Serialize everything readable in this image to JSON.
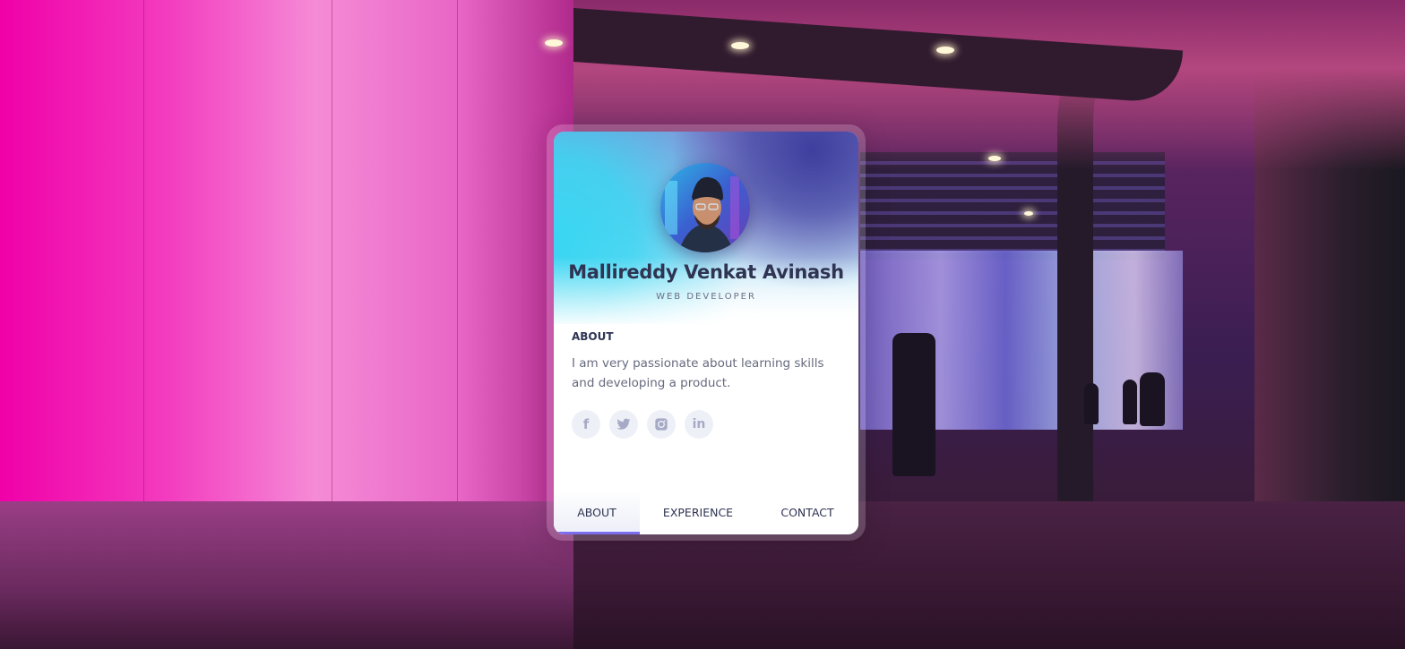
{
  "profile": {
    "name": "Mallireddy Venkat Avinash",
    "role": "WEB DEVELOPER"
  },
  "about": {
    "title": "ABOUT",
    "text": "I am very passionate about learning skills and developing a product."
  },
  "socials": [
    {
      "icon": "facebook-icon",
      "glyph": "f"
    },
    {
      "icon": "twitter-icon",
      "glyph": ""
    },
    {
      "icon": "instagram-icon",
      "glyph": ""
    },
    {
      "icon": "linkedin-icon",
      "glyph": "in"
    }
  ],
  "tabs": [
    {
      "label": "ABOUT",
      "active": true
    },
    {
      "label": "EXPERIENCE",
      "active": false
    },
    {
      "label": "CONTACT",
      "active": false
    }
  ],
  "colors": {
    "accent": "#7c6cf0",
    "name_text": "#2e3452",
    "body_text": "#666a7e",
    "icon_color": "#a6aac4"
  }
}
